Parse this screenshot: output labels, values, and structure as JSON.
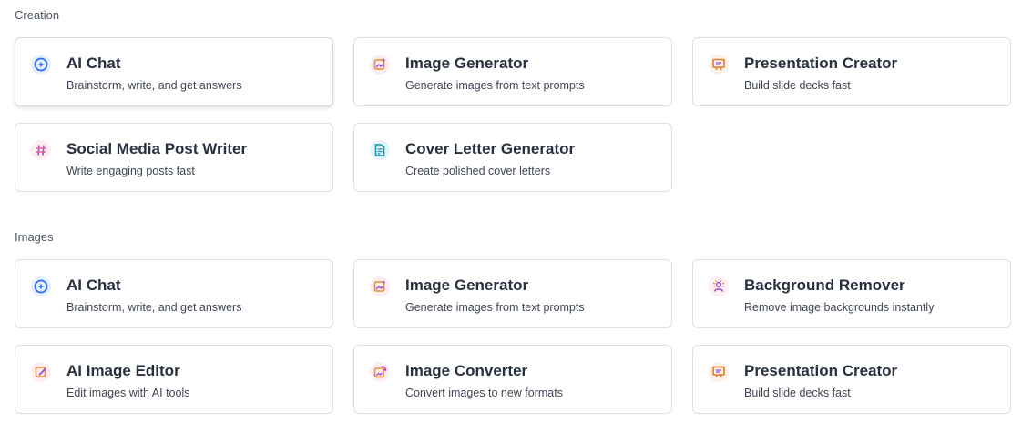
{
  "sections": [
    {
      "label": "Creation",
      "cards": [
        {
          "title": "AI Chat",
          "desc": "Brainstorm, write, and get answers",
          "icon": "ai-chat-icon"
        },
        {
          "title": "Image Generator",
          "desc": "Generate images from text prompts",
          "icon": "image-generator-icon"
        },
        {
          "title": "Presentation Creator",
          "desc": "Build slide decks fast",
          "icon": "presentation-icon"
        },
        {
          "title": "Social Media Post Writer",
          "desc": "Write engaging posts fast",
          "icon": "hashtag-icon"
        },
        {
          "title": "Cover Letter Generator",
          "desc": "Create polished cover letters",
          "icon": "document-icon"
        }
      ]
    },
    {
      "label": "Images",
      "cards": [
        {
          "title": "AI Chat",
          "desc": "Brainstorm, write, and get answers",
          "icon": "ai-chat-icon"
        },
        {
          "title": "Image Generator",
          "desc": "Generate images from text prompts",
          "icon": "image-generator-icon"
        },
        {
          "title": "Background Remover",
          "desc": "Remove image backgrounds instantly",
          "icon": "background-remover-icon"
        },
        {
          "title": "AI Image Editor",
          "desc": "Edit images with AI tools",
          "icon": "image-editor-icon"
        },
        {
          "title": "Image Converter",
          "desc": "Convert images to new formats",
          "icon": "image-converter-icon"
        },
        {
          "title": "Presentation Creator",
          "desc": "Build slide decks fast",
          "icon": "presentation-icon"
        }
      ]
    }
  ],
  "colors": {
    "accent_blue": "#2f6df6",
    "accent_purple": "#9b4dd6",
    "accent_orange": "#f08a24",
    "accent_teal": "#1f8fb0",
    "card_border": "#dcdfe4"
  }
}
